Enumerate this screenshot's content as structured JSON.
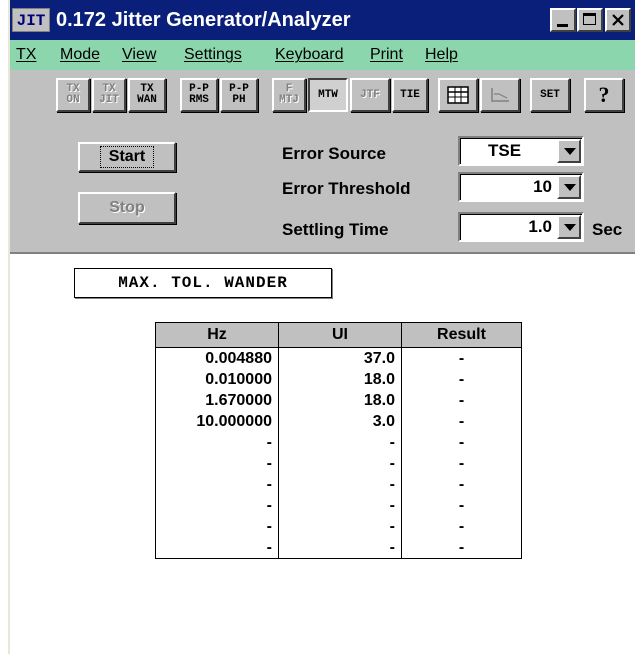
{
  "window": {
    "icon_text": "JIT",
    "title": "0.172 Jitter Generator/Analyzer"
  },
  "menu": [
    "TX",
    "Mode",
    "View",
    "Settings",
    "Keyboard",
    "Print",
    "Help"
  ],
  "toolbar": {
    "tx_on": "TX\nON",
    "tx_jit": "TX\nJIT",
    "tx_wan": "TX\nWAN",
    "pp_rms": "P-P\nRMS",
    "pp_ph": "P-P\nPH",
    "f_mtj": "F\nMTJ",
    "mtw": "MTW",
    "jtf": "JTF",
    "tie": "TIE",
    "set": "SET",
    "help": "?"
  },
  "controls": {
    "start_label": "Start",
    "stop_label": "Stop",
    "error_source_label": "Error Source",
    "error_source_value": "TSE",
    "error_threshold_label": "Error Threshold",
    "error_threshold_value": "10",
    "settling_time_label": "Settling Time",
    "settling_time_value": "1.0",
    "settling_time_unit": "Sec"
  },
  "mode_title": "MAX. TOL. WANDER",
  "table": {
    "headers": [
      "Hz",
      "UI",
      "Result"
    ],
    "rows": [
      [
        "0.004880",
        "37.0",
        "-"
      ],
      [
        "0.010000",
        "18.0",
        "-"
      ],
      [
        "1.670000",
        "18.0",
        "-"
      ],
      [
        "10.000000",
        "3.0",
        "-"
      ],
      [
        "-",
        "-",
        "-"
      ],
      [
        "-",
        "-",
        "-"
      ],
      [
        "-",
        "-",
        "-"
      ],
      [
        "-",
        "-",
        "-"
      ],
      [
        "-",
        "-",
        "-"
      ],
      [
        "-",
        "-",
        "-"
      ]
    ]
  }
}
